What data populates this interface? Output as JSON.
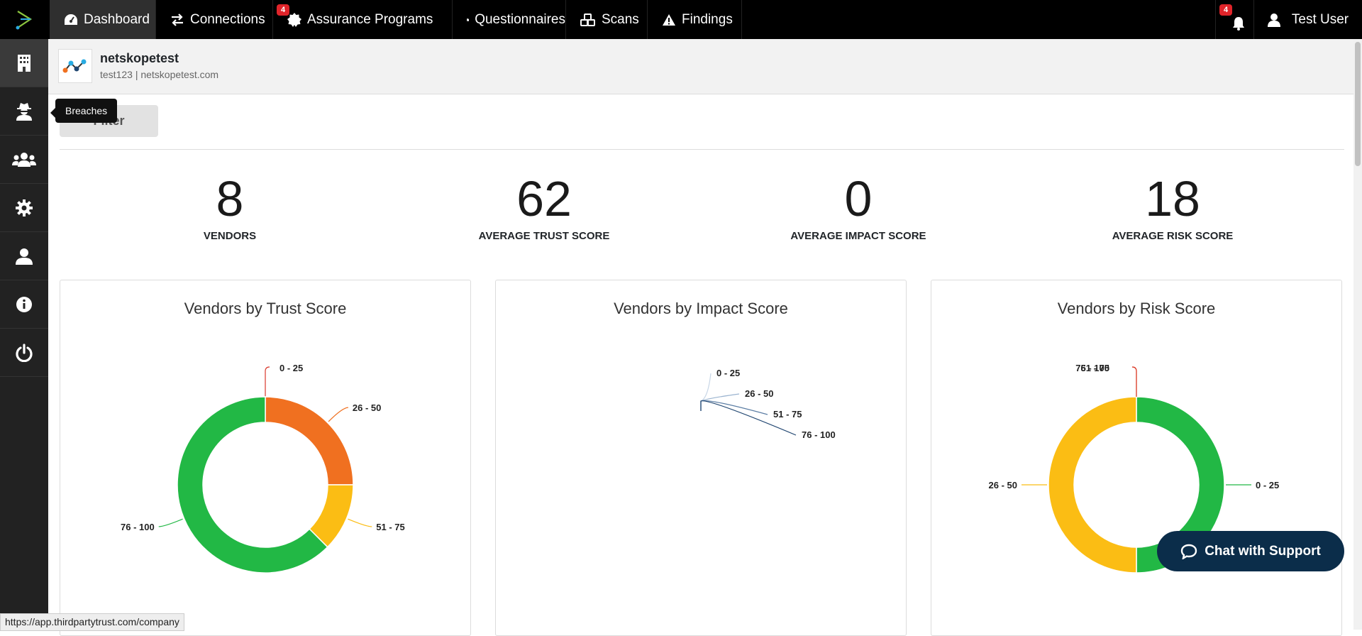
{
  "topnav": {
    "items": [
      {
        "label": "Dashboard",
        "icon": "dashboard-gauge-icon"
      },
      {
        "label": "Connections",
        "icon": "exchange-arrows-icon"
      },
      {
        "label": "Assurance Programs",
        "icon": "certificate-badge-icon",
        "badge": "4"
      },
      {
        "label": "Questionnaires",
        "icon": "document-icon"
      },
      {
        "label": "Scans",
        "icon": "cubes-icon"
      },
      {
        "label": "Findings",
        "icon": "warning-icon"
      }
    ],
    "notifications_badge": "4",
    "user_label": "Test User"
  },
  "sidebar": {
    "items": [
      "building-icon",
      "user-secret-icon",
      "users-icon",
      "gear-icon",
      "user-icon",
      "info-icon",
      "power-icon"
    ],
    "tooltip": "Breaches"
  },
  "company": {
    "name": "netskopetest",
    "subtitle": "test123 | netskopetest.com"
  },
  "filter_label": "Filter",
  "stats": [
    {
      "value": "8",
      "label": "VENDORS"
    },
    {
      "value": "62",
      "label": "AVERAGE TRUST SCORE"
    },
    {
      "value": "0",
      "label": "AVERAGE IMPACT SCORE"
    },
    {
      "value": "18",
      "label": "AVERAGE RISK SCORE"
    }
  ],
  "chart_data": [
    {
      "type": "pie",
      "title": "Vendors by Trust Score",
      "categories": [
        "0 - 25",
        "26 - 50",
        "51 - 75",
        "76 - 100"
      ],
      "values": [
        0,
        2,
        1,
        5
      ],
      "colors": [
        "#d9372b",
        "#f07020",
        "#fbbd14",
        "#22b845"
      ],
      "donut": true
    },
    {
      "type": "pie",
      "title": "Vendors by Impact Score",
      "categories": [
        "0 - 25",
        "26 - 50",
        "51 - 75",
        "76 - 100"
      ],
      "values": [
        0,
        0,
        0,
        0
      ],
      "colors": [
        "#c8d6e6",
        "#9bb4d0",
        "#5a7ca3",
        "#1f4570"
      ],
      "donut": true
    },
    {
      "type": "pie",
      "title": "Vendors by Risk Score",
      "categories": [
        "0 - 25",
        "26 - 50",
        "51 - 75",
        "76 - 100"
      ],
      "values": [
        4,
        4,
        0,
        0
      ],
      "colors": [
        "#22b845",
        "#fbbd14",
        "#f07020",
        "#d9372b"
      ],
      "donut": true
    }
  ],
  "chat_label": "Chat with Support",
  "status_url": "https://app.thirdpartytrust.com/company"
}
